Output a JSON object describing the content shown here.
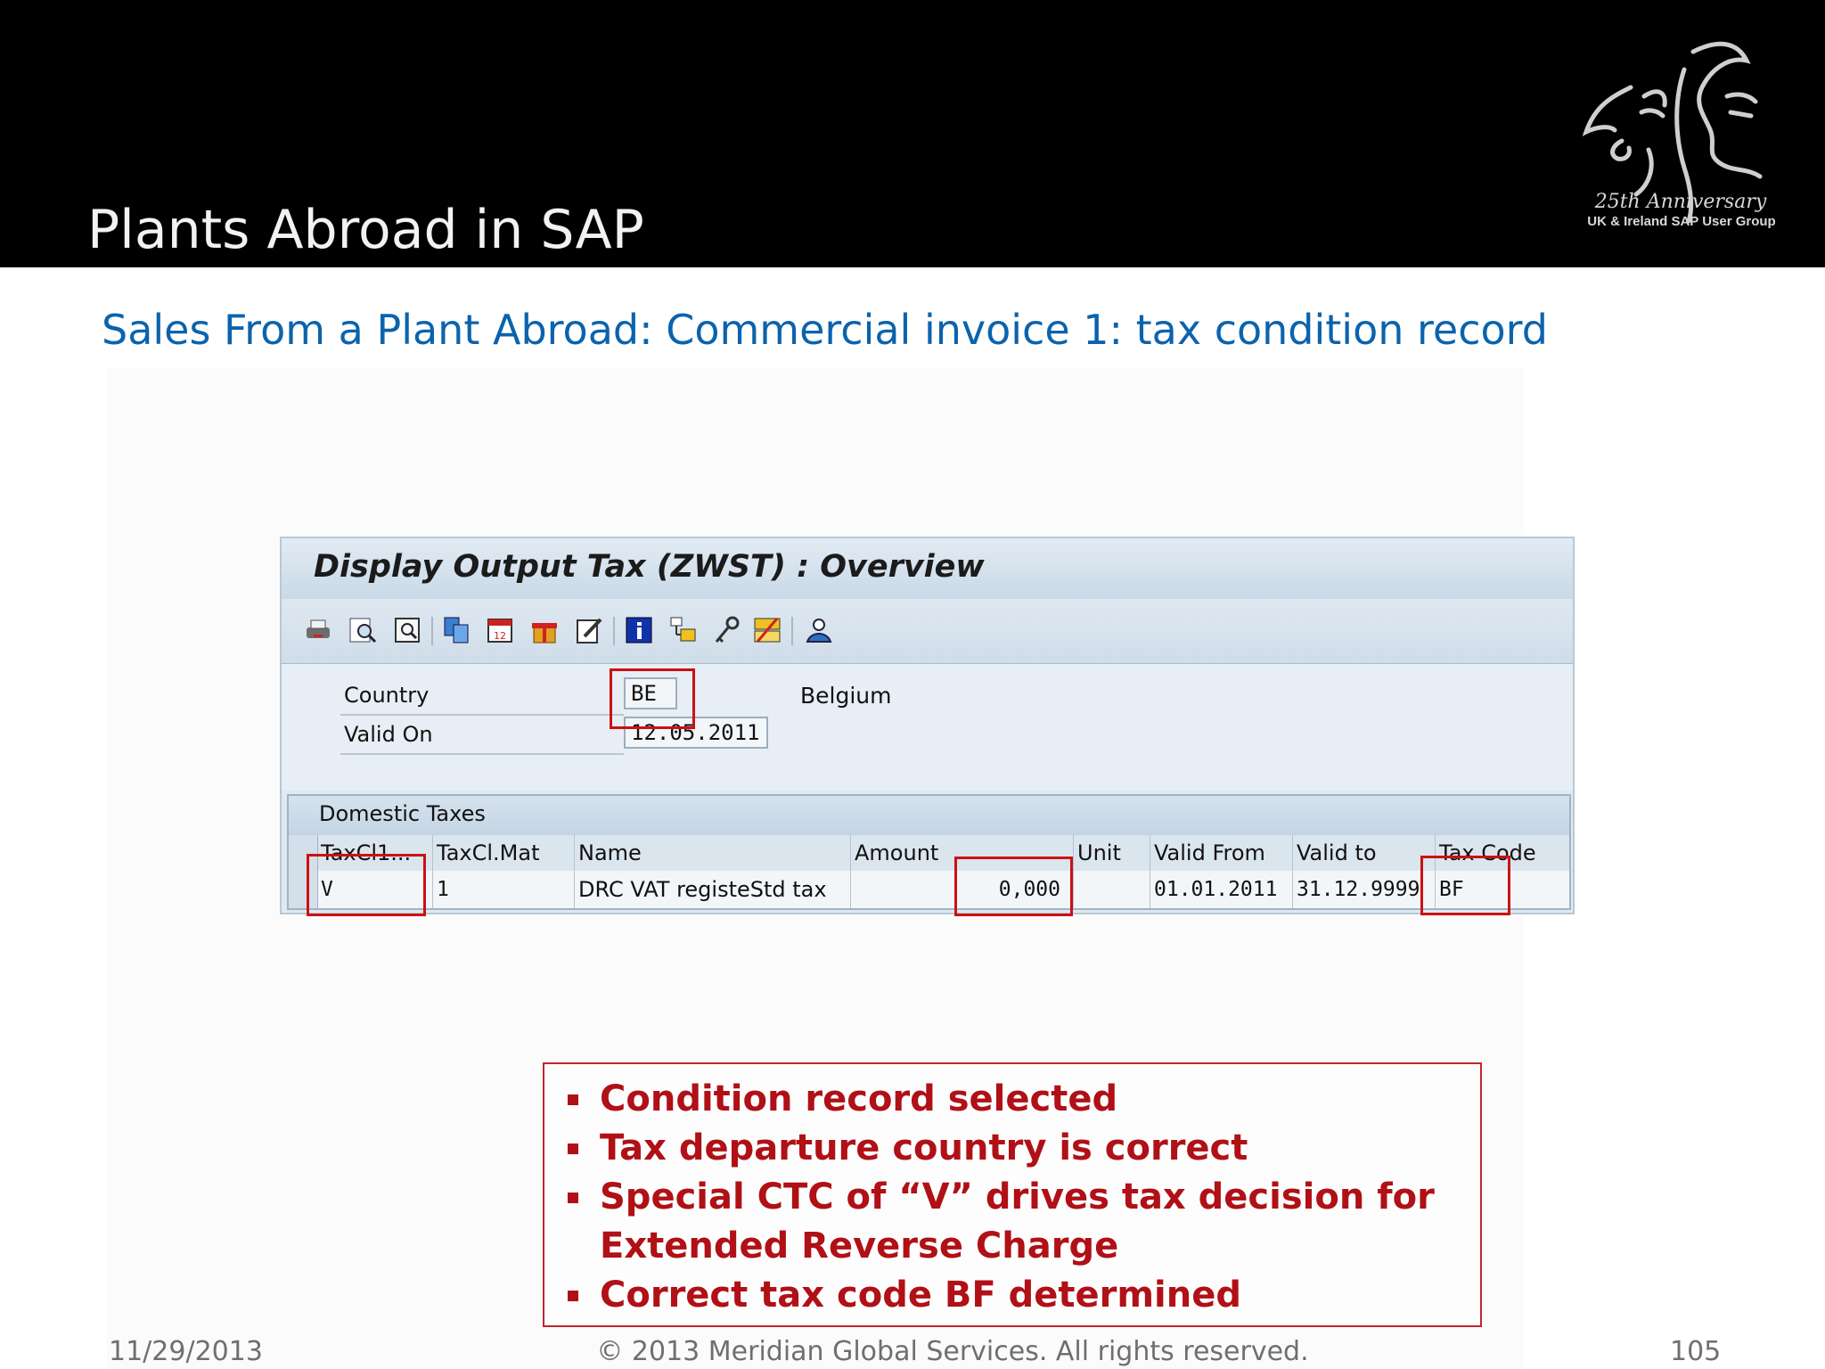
{
  "slide": {
    "title": "Plants Abroad in SAP",
    "subtitle": "Sales From a Plant Abroad: Commercial invoice 1: tax condition record",
    "logo": {
      "anniversary": "25th Anniversary",
      "group": "UK & Ireland SAP User Group",
      "icon": "face-profile-logo"
    }
  },
  "sap": {
    "window_title": "Display Output Tax (ZWST) : Overview",
    "toolbar_icons": [
      "print-icon",
      "find-icon",
      "find-next-icon",
      "copy-icon",
      "calendar-icon",
      "gift-icon",
      "edit-icon",
      "info-icon",
      "structure-icon",
      "key-icon",
      "condition-icon",
      "user-icon"
    ],
    "form": {
      "country_label": "Country",
      "country_value": "BE",
      "country_name": "Belgium",
      "valid_on_label": "Valid On",
      "valid_on_value": "12.05.2011"
    },
    "table": {
      "title": "Domestic Taxes",
      "columns": [
        "TaxCl1...",
        "TaxCl.Mat",
        "Name",
        "Amount",
        "Unit",
        "Valid From",
        "Valid to",
        "Tax Code"
      ],
      "rows": [
        [
          "V",
          "1",
          "DRC VAT registeStd tax",
          "0,000",
          "",
          "01.01.2011",
          "31.12.9999",
          "BF"
        ]
      ]
    }
  },
  "callout": {
    "items": [
      "Condition record selected",
      "Tax departure country is correct",
      "Special CTC of “V” drives tax decision for Extended Reverse Charge",
      "Correct tax code BF determined"
    ]
  },
  "footer": {
    "date": "11/29/2013",
    "copyright": "© 2013 Meridian Global Services. All rights reserved.",
    "page_number": "105"
  },
  "colors": {
    "header_bg": "#000000",
    "subtitle": "#0b63ad",
    "callout_text": "#b01016",
    "highlight": "#cc1111"
  }
}
